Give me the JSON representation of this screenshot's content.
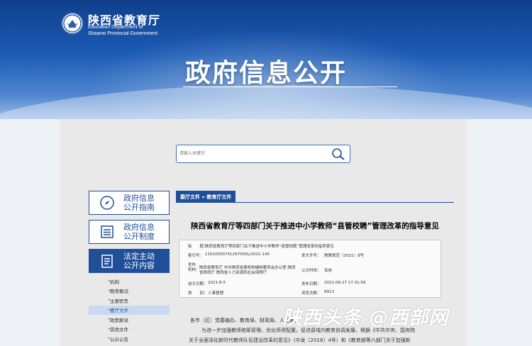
{
  "header": {
    "org_name": "陕西省教育厅",
    "org_en_line1": "Education Department of",
    "org_en_line2": "Shaanxi Provincial Government",
    "banner_title": "政府信息公开"
  },
  "search": {
    "placeholder": "请输入关键字"
  },
  "sidebar": {
    "cards": [
      {
        "line1": "政府信息",
        "line2": "公开指南",
        "icon": "compass-icon"
      },
      {
        "line1": "政府信息",
        "line2": "公开制度",
        "icon": "list-icon"
      },
      {
        "line1": "法定主动",
        "line2": "公开内容",
        "icon": "clipboard-icon"
      }
    ],
    "sub_items": [
      "机构",
      "教育概况",
      "主要职责",
      "委厅文件",
      "政策解读",
      "其他文件",
      "公示公告"
    ]
  },
  "breadcrumb": "委厅文件 » 教育厅文件",
  "article": {
    "title": "陕西省教育厅等四部门关于推进中小学教师“县管校聘”管理改革的指导意见",
    "meta": {
      "title_label": "标　　题：",
      "title_value": "陕西省教育厅等四部门关于推进中小学教师“县管校聘”管理改革的指导意见",
      "index_label": "索引号：",
      "index_value": "11610000741297059L/2021-145",
      "docno_label": "发文字号：",
      "docno_value": "陕教规范〔2021〕8号",
      "issuer_label1": "发布",
      "issuer_label2": "机构：",
      "issuer_value1": "陕西省教育厅 中共陕西省委机构编制委员会办公室 陕西",
      "issuer_value2": "省财政厅 陕西省人力资源和社会保障厅",
      "validity_label": "公文时效：",
      "validity_value": "有效",
      "created_label": "成文日期：",
      "created_value": "2021-8-5",
      "published_label": "发布日期：",
      "published_value": "2021-08-27 17:31:58",
      "category_label": "类　　别：",
      "category_value": "人事管理",
      "views_label": "浏览次数：",
      "views_value": "8913"
    },
    "body_lines": [
      "各市（区）党委编办、教育局、财政局、人社局：",
      "为进一步加强教师统筹管理，优化师资配置，促进县域内教育协调发展，根据《中共中央、国务院",
      "关于全面深化新时代教师队伍建设改革的意见》（中发〔2018〕4号）和《教育部等六部门关于加强新"
    ]
  },
  "watermark": "陕西头条 @西部网"
}
